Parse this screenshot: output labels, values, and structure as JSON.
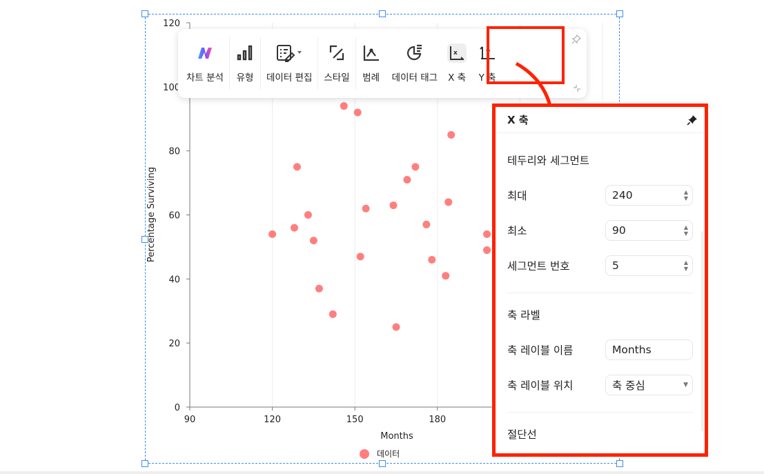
{
  "chart_data": {
    "type": "scatter",
    "xlabel": "Months",
    "ylabel": "Percentage Surviving",
    "xlim": [
      90,
      240
    ],
    "ylim": [
      0,
      120
    ],
    "x_ticks": [
      "90",
      "120",
      "150",
      "180"
    ],
    "y_ticks": [
      "0",
      "20",
      "40",
      "60",
      "80",
      "100",
      "120"
    ],
    "grid": "vertical",
    "legend": {
      "position": "bottom",
      "label": "데이터"
    },
    "color": "#ff7f7f",
    "points": [
      [
        120,
        54
      ],
      [
        128,
        56
      ],
      [
        129,
        75
      ],
      [
        133,
        60
      ],
      [
        135,
        52
      ],
      [
        137,
        37
      ],
      [
        142,
        29
      ],
      [
        146,
        94
      ],
      [
        151,
        92
      ],
      [
        152,
        47
      ],
      [
        154,
        62
      ],
      [
        164,
        63
      ],
      [
        165,
        25
      ],
      [
        169,
        71
      ],
      [
        172,
        75
      ],
      [
        176,
        57
      ],
      [
        178,
        46
      ],
      [
        183,
        41
      ],
      [
        184,
        64
      ],
      [
        185,
        85
      ],
      [
        198,
        54
      ],
      [
        198,
        49
      ]
    ]
  },
  "toolbar": {
    "items": [
      {
        "label": "차트 분석",
        "icon": "ai-logo-icon"
      },
      {
        "label": "유형",
        "icon": "bar-chart-icon"
      },
      {
        "label": "데이터 편집",
        "icon": "edit-data-icon"
      },
      {
        "label": "스타일",
        "icon": "style-brush-icon"
      },
      {
        "label": "범례",
        "icon": "legend-icon"
      },
      {
        "label": "데이터 태그",
        "icon": "pie-tag-icon"
      },
      {
        "label": "X 축",
        "icon": "x-axis-icon"
      },
      {
        "label": "Y 축",
        "icon": "y-axis-icon"
      }
    ]
  },
  "panel": {
    "title": "X 축",
    "section1": "테두리와 세그먼트",
    "max_label": "최대",
    "max_value": "240",
    "min_label": "최소",
    "min_value": "90",
    "seg_label": "세그먼트 번호",
    "seg_value": "5",
    "section2": "축 라벨",
    "name_label": "축 레이블 이름",
    "name_value": "Months",
    "pos_label": "축 레이블 위치",
    "pos_value": "축 중심",
    "section3": "절단선"
  },
  "accent": "#ff2200"
}
